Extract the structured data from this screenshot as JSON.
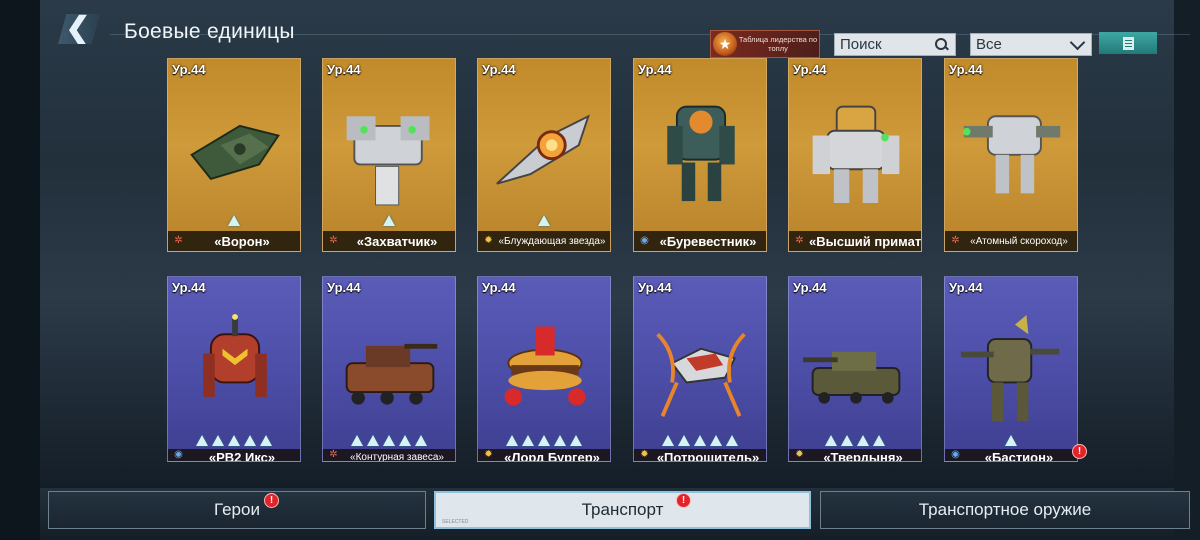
{
  "header": {
    "back_icon": "chevron-left-icon",
    "title": "Боевые единицы",
    "leaderboard_label": "Таблица лидерства по топлу",
    "search_placeholder": "Поиск",
    "filter_value": "Все",
    "notes_icon": "notes-icon"
  },
  "colors": {
    "gold_card": "#c18a2a",
    "purple_card": "#5a5cb8",
    "alert": "#e0242a",
    "teal_button": "#3fa7a3"
  },
  "cards": [
    {
      "level": "Ур.44",
      "name": "«Ворон»",
      "stars": 1,
      "rarity": "gold",
      "class": "atk"
    },
    {
      "level": "Ур.44",
      "name": "«Захватчик»",
      "stars": 1,
      "rarity": "gold",
      "class": "atk"
    },
    {
      "level": "Ур.44",
      "name": "«Блуждающая звезда»",
      "stars": 1,
      "rarity": "gold",
      "class": "sup"
    },
    {
      "level": "Ур.44",
      "name": "«Буревестник»",
      "stars": 0,
      "rarity": "gold",
      "class": "def"
    },
    {
      "level": "Ур.44",
      "name": "«Высший примат»",
      "stars": 0,
      "rarity": "gold",
      "class": "atk"
    },
    {
      "level": "Ур.44",
      "name": "«Атомный скороход»",
      "stars": 0,
      "rarity": "gold",
      "class": "atk"
    },
    {
      "level": "Ур.44",
      "name": "«PB2 Икс»",
      "stars": 5,
      "rarity": "purple",
      "class": "def"
    },
    {
      "level": "Ур.44",
      "name": "«Контурная завеса»",
      "stars": 5,
      "rarity": "purple",
      "class": "atk"
    },
    {
      "level": "Ур.44",
      "name": "«Лорд Бургер»",
      "stars": 5,
      "rarity": "purple",
      "class": "sup"
    },
    {
      "level": "Ур.44",
      "name": "«Потрошитель»",
      "stars": 5,
      "rarity": "purple",
      "class": "sup"
    },
    {
      "level": "Ур.44",
      "name": "«Твердыня»",
      "stars": 4,
      "rarity": "purple",
      "class": "sup"
    },
    {
      "level": "Ур.44",
      "name": "«Бастион»",
      "stars": 1,
      "rarity": "purple",
      "class": "def"
    }
  ],
  "tabs": [
    {
      "label": "Герои",
      "alert": "!"
    },
    {
      "label": "Транспорт",
      "alert": "!",
      "selected_mark": "SELECTED"
    },
    {
      "label": "Транспортное оружие"
    }
  ],
  "card_alert": "!"
}
